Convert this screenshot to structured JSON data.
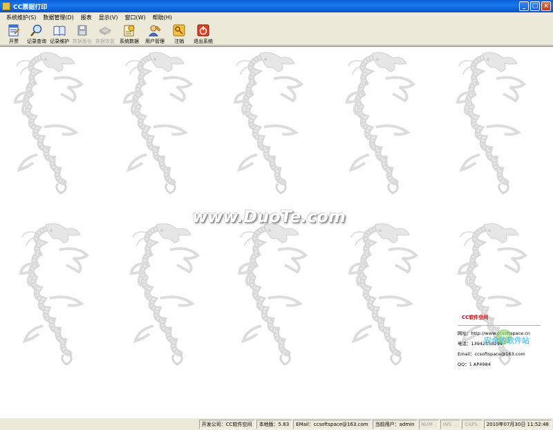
{
  "window": {
    "title": "CC票据打印"
  },
  "menu": [
    "系统维护(S)",
    "数据管理(D)",
    "报表",
    "显示(V)",
    "窗口(W)",
    "帮助(H)"
  ],
  "toolbar": [
    {
      "label": "开票",
      "icon": "invoice-icon",
      "enabled": true
    },
    {
      "label": "记录查询",
      "icon": "magnifier-icon",
      "enabled": true
    },
    {
      "label": "记录维护",
      "icon": "book-icon",
      "enabled": true
    },
    {
      "label": "数据备份",
      "icon": "backup-icon",
      "enabled": false
    },
    {
      "label": "数据恢复",
      "icon": "restore-icon",
      "enabled": false
    },
    {
      "label": "系统数据",
      "icon": "system-data-icon",
      "enabled": true
    },
    {
      "label": "用户管理",
      "icon": "user-manage-icon",
      "enabled": true
    },
    {
      "label": "注销",
      "icon": "logout-key-icon",
      "enabled": true
    },
    {
      "label": "退出系统",
      "icon": "exit-icon",
      "enabled": true
    }
  ],
  "watermark": "www.DuoTe.com",
  "info": {
    "title": "CC软件空间",
    "website": "网址：http://www.ccsoftspace.cn",
    "phone": "电话：13942558294",
    "email": "Email：ccsoftspace@163.com",
    "qq": "QQ：1 AP4984"
  },
  "stamp_text": "安全的软件站",
  "status": {
    "company": "开发公司：CC软件空间",
    "version": "本地版：5.83",
    "email": "EMail：ccsoftspace@163.com",
    "user": "当前用户：admin",
    "num": "NUM",
    "ins": "INS",
    "caps": "CAPS",
    "datetime": "2010年07月30日 11:52:48"
  },
  "colors": {
    "titlebar": "#0a5fd8",
    "info_title": "#d10000",
    "stamp": "#3fb4e6"
  }
}
